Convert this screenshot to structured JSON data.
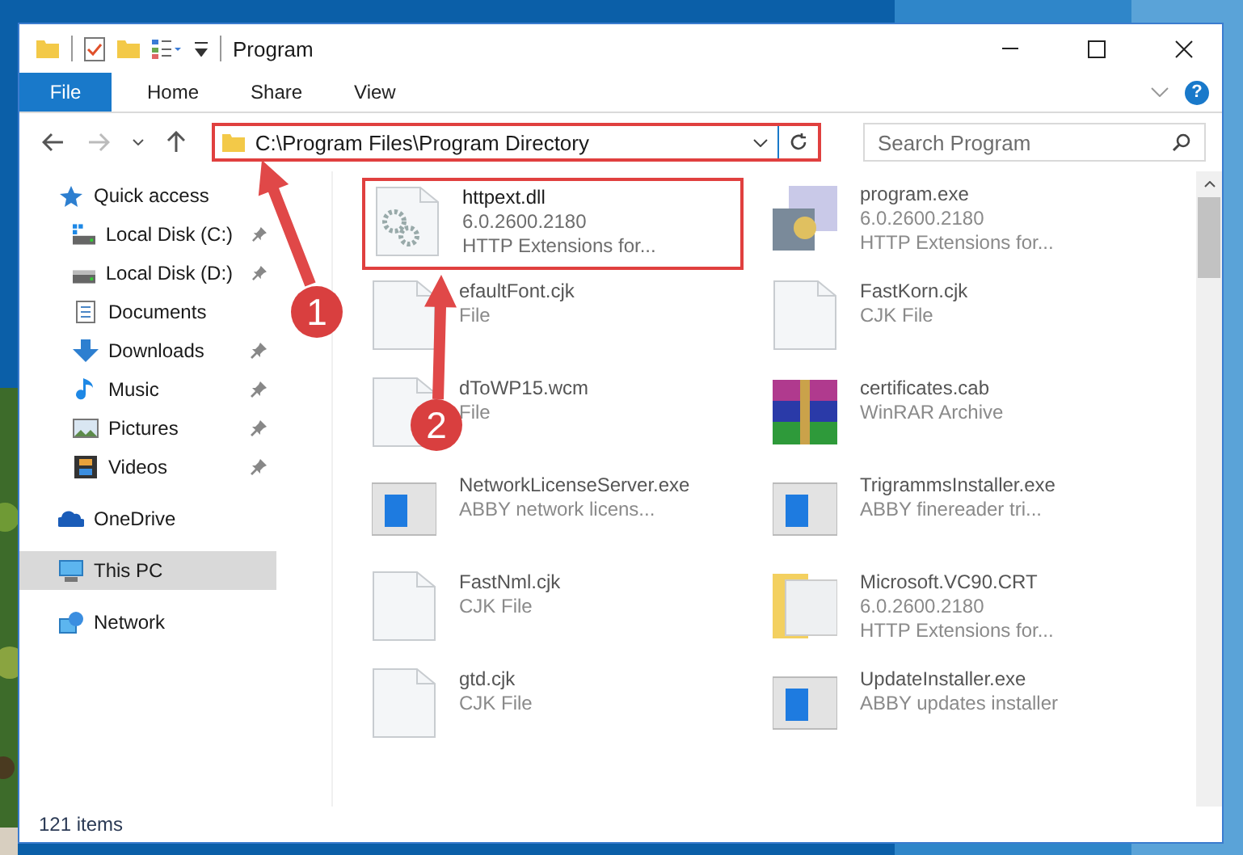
{
  "window": {
    "title": "Program"
  },
  "ribbon": {
    "tabs": [
      {
        "label": "File",
        "selected": true
      },
      {
        "label": "Home",
        "selected": false
      },
      {
        "label": "Share",
        "selected": false
      },
      {
        "label": "View",
        "selected": false
      }
    ],
    "help": "?"
  },
  "address": {
    "path": "C:\\Program Files\\Program Directory",
    "highlighted": true
  },
  "search": {
    "placeholder": "Search Program"
  },
  "sidebar": {
    "items": [
      {
        "label": "Quick access",
        "kind": "star",
        "selected": false,
        "children": [
          {
            "label": "Local Disk (C:)",
            "kind": "system-drive",
            "pinned": true,
            "selected": false
          },
          {
            "label": "Local Disk (D:)",
            "kind": "drive",
            "pinned": true,
            "selected": false
          },
          {
            "label": "Documents",
            "kind": "document",
            "pinned": false,
            "selected": false
          },
          {
            "label": "Downloads",
            "kind": "download",
            "pinned": true,
            "selected": false
          },
          {
            "label": "Music",
            "kind": "music",
            "pinned": true,
            "selected": false
          },
          {
            "label": "Pictures",
            "pinned": true,
            "selected": false
          },
          {
            "label": "Videos",
            "kind": "film",
            "pinned": true,
            "selected": false
          }
        ]
      },
      {
        "label": "OneDrive",
        "kind": "cloud",
        "selected": false
      },
      {
        "label": "This PC",
        "kind": "computer",
        "selected": true
      },
      {
        "label": "Network",
        "kind": "network",
        "selected": false
      }
    ]
  },
  "files": [
    {
      "kind": "library",
      "lines": [
        "httpext.dll",
        "6.0.2600.2180",
        "HTTP Extensions for..."
      ],
      "highlighted": true,
      "blurred": false
    },
    {
      "kind": "setup",
      "lines": [
        "program.exe",
        "6.0.2600.2180",
        "HTTP Extensions for..."
      ],
      "highlighted": false,
      "blurred": true
    },
    {
      "kind": "blank",
      "lines": [
        "efaultFont.cjk",
        "File"
      ],
      "highlighted": false,
      "blurred": true
    },
    {
      "kind": "blank",
      "lines": [
        "FastKorn.cjk",
        "CJK File"
      ],
      "highlighted": false,
      "blurred": true
    },
    {
      "kind": "blank",
      "lines": [
        "dToWP15.wcm",
        "File"
      ],
      "highlighted": false,
      "blurred": true
    },
    {
      "kind": "archive",
      "lines": [
        "certificates.cab",
        "WinRAR Archive"
      ],
      "highlighted": false,
      "blurred": true
    },
    {
      "kind": "app",
      "lines": [
        "NetworkLicenseServer.exe",
        "ABBY network licens..."
      ],
      "highlighted": false,
      "blurred": true
    },
    {
      "kind": "app",
      "lines": [
        "TrigrammsInstaller.exe",
        "ABBY finereader tri..."
      ],
      "highlighted": false,
      "blurred": true
    },
    {
      "kind": "blank",
      "lines": [
        "FastNml.cjk",
        "CJK File"
      ],
      "highlighted": false,
      "blurred": true
    },
    {
      "kind": "folder",
      "lines": [
        "Microsoft.VC90.CRT",
        "6.0.2600.2180",
        "HTTP Extensions for..."
      ],
      "highlighted": false,
      "blurred": true
    },
    {
      "kind": "blank",
      "lines": [
        "gtd.cjk",
        "CJK File"
      ],
      "highlighted": false,
      "blurred": true
    },
    {
      "kind": "app",
      "lines": [
        "UpdateInstaller.exe",
        "ABBY updates installer"
      ],
      "highlighted": false,
      "blurred": true
    }
  ],
  "status_bar": {
    "count": "121 items"
  },
  "callouts": [
    {
      "number": "1"
    },
    {
      "number": "2"
    }
  ]
}
